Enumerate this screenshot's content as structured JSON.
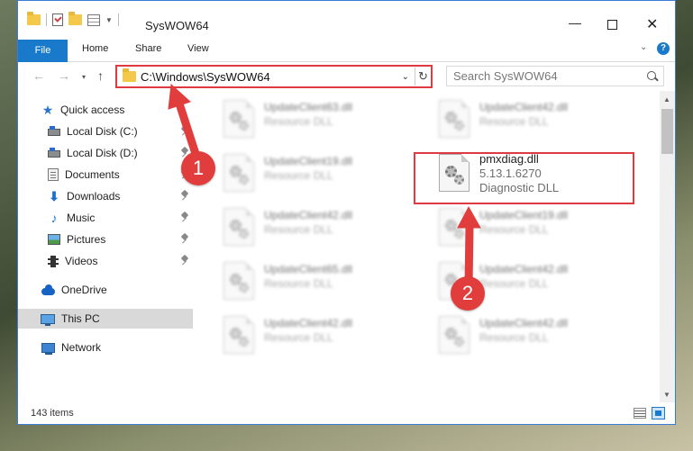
{
  "window": {
    "title": "SysWOW64",
    "min_glyph": "—",
    "close_glyph": "✕"
  },
  "ribbon": {
    "tabs": [
      "File",
      "Home",
      "Share",
      "View"
    ]
  },
  "address": {
    "path": "C:\\Windows\\SysWOW64",
    "refresh_glyph": "↻",
    "dropdown_glyph": "⌄"
  },
  "search": {
    "placeholder": "Search SysWOW64"
  },
  "nav": {
    "back": "←",
    "forward": "→",
    "recent": "▾",
    "up": "↑"
  },
  "sidebar": {
    "items": [
      {
        "label": "Quick access",
        "icon": "star-icon"
      },
      {
        "label": "Local Disk (C:)",
        "icon": "disk-icon",
        "pinned": true
      },
      {
        "label": "Local Disk (D:)",
        "icon": "disk-icon",
        "pinned": true
      },
      {
        "label": "Documents",
        "icon": "documents-icon",
        "pinned": true
      },
      {
        "label": "Downloads",
        "icon": "downloads-icon",
        "pinned": true
      },
      {
        "label": "Music",
        "icon": "music-icon",
        "pinned": true
      },
      {
        "label": "Pictures",
        "icon": "pictures-icon",
        "pinned": true
      },
      {
        "label": "Videos",
        "icon": "videos-icon",
        "pinned": true
      },
      {
        "label": "OneDrive",
        "icon": "onedrive-icon"
      },
      {
        "label": "This PC",
        "icon": "this-pc-icon",
        "selected": true
      },
      {
        "label": "Network",
        "icon": "network-icon"
      }
    ]
  },
  "files": [
    {
      "name": "UpdateClient63.dll",
      "type": "Resource DLL"
    },
    {
      "name": "UpdateClient42.dll",
      "type": "Resource DLL"
    },
    {
      "name": "UpdateClient19.dll",
      "type": "Resource DLL"
    },
    {
      "name": "pmxdiag.dll",
      "version": "5.13.1.6270",
      "type": "Diagnostic DLL",
      "highlighted": true
    },
    {
      "name": "UpdateClient42.dll",
      "type": "Resource DLL"
    },
    {
      "name": "UpdateClient19.dll",
      "type": "Resource DLL"
    },
    {
      "name": "UpdateClient65.dll",
      "type": "Resource DLL"
    },
    {
      "name": "UpdateClient42.dll",
      "type": "Resource DLL"
    },
    {
      "name": "UpdateClient42.dll",
      "type": "Resource DLL"
    },
    {
      "name": "UpdateClient42.dll",
      "type": "Resource DLL"
    }
  ],
  "status": {
    "item_count": "143 items"
  },
  "annotations": {
    "marker_1": "1",
    "marker_2": "2",
    "color": "#e23d3d"
  },
  "colors": {
    "accent": "#1979ca",
    "highlight_border": "#e0393f",
    "selected_bg": "#d9d9d9"
  }
}
